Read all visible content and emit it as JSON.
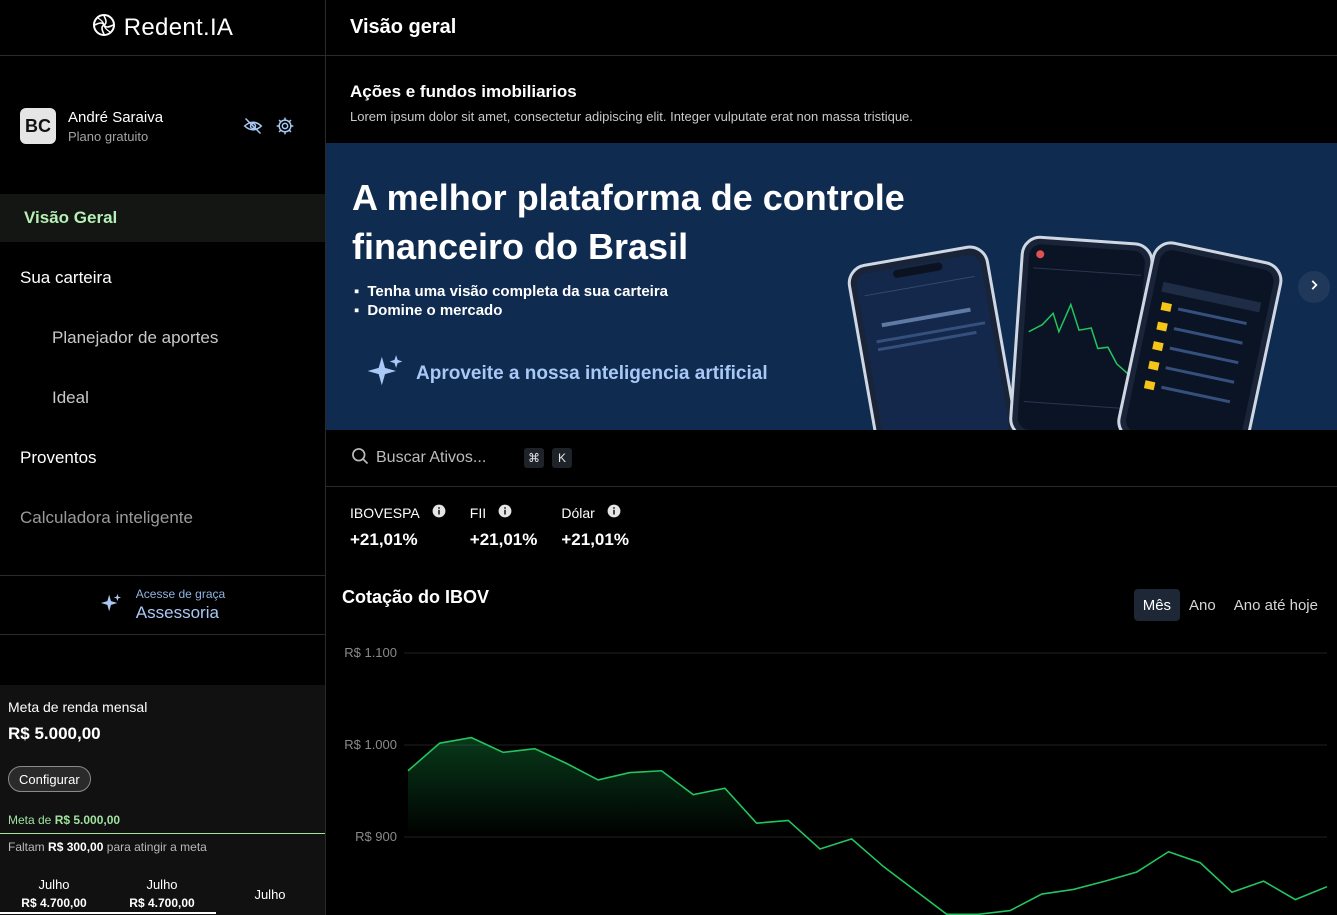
{
  "app": {
    "name": "Redent.IA"
  },
  "profile": {
    "initials": "BC",
    "name": "André Saraiva",
    "plan": "Plano gratuito"
  },
  "nav": {
    "items": [
      {
        "label": "Visão Geral"
      },
      {
        "label": "Sua carteira"
      },
      {
        "label": "Planejador de aportes"
      },
      {
        "label": "Ideal"
      },
      {
        "label": "Proventos"
      },
      {
        "label": "Calculadora inteligente"
      }
    ]
  },
  "advisory": {
    "top": "Acesse de graça",
    "main": "Assessoria"
  },
  "goal": {
    "title": "Meta de renda mensal",
    "amount": "R$ 5.000,00",
    "config_label": "Configurar",
    "meta_prefix": "Meta de",
    "meta_value": "R$ 5.000,00",
    "missing_prefix": "Faltam",
    "missing_value": "R$ 300,00",
    "missing_suffix": "para atingir a meta",
    "months": [
      {
        "name": "Julho",
        "value": "R$ 4.700,00"
      },
      {
        "name": "Julho",
        "value": "R$ 4.700,00"
      },
      {
        "name": "Julho",
        "value": ""
      }
    ]
  },
  "header": {
    "title": "Visão geral"
  },
  "section": {
    "title": "Ações e fundos imobiliarios",
    "description": "Lorem ipsum dolor sit amet, consectetur adipiscing elit. Integer vulputate erat non massa tristique."
  },
  "banner": {
    "headline_line1": "A melhor plataforma de controle",
    "headline_line2": "financeiro do Brasil",
    "bullets": [
      "Tenha uma visão completa da sua carteira",
      "Domine o mercado"
    ],
    "cta": "Aproveite a nossa inteligencia artificial"
  },
  "search": {
    "placeholder": "Buscar Ativos...",
    "shortcut_key1": "⌘",
    "shortcut_key2": "K"
  },
  "indices": [
    {
      "name": "IBOVESPA",
      "value": "+21,01%"
    },
    {
      "name": "FII",
      "value": "+21,01%"
    },
    {
      "name": "Dólar",
      "value": "+21,01%"
    }
  ],
  "chart_tabs": [
    "Mês",
    "Ano",
    "Ano até hoje"
  ],
  "chart_data": {
    "type": "area",
    "title": "Cotação do IBOV",
    "y_ticks": [
      "R$ 1.100",
      "R$ 1.000",
      "R$ 900"
    ],
    "ylim": [
      800,
      1100
    ],
    "values": [
      972,
      1002,
      1008,
      992,
      996,
      980,
      962,
      970,
      972,
      946,
      953,
      915,
      918,
      887,
      898,
      868,
      842,
      816,
      816,
      820,
      838,
      843,
      852,
      862,
      884,
      872,
      840,
      852,
      832,
      846
    ],
    "color": "#22c55e",
    "grid": true
  }
}
